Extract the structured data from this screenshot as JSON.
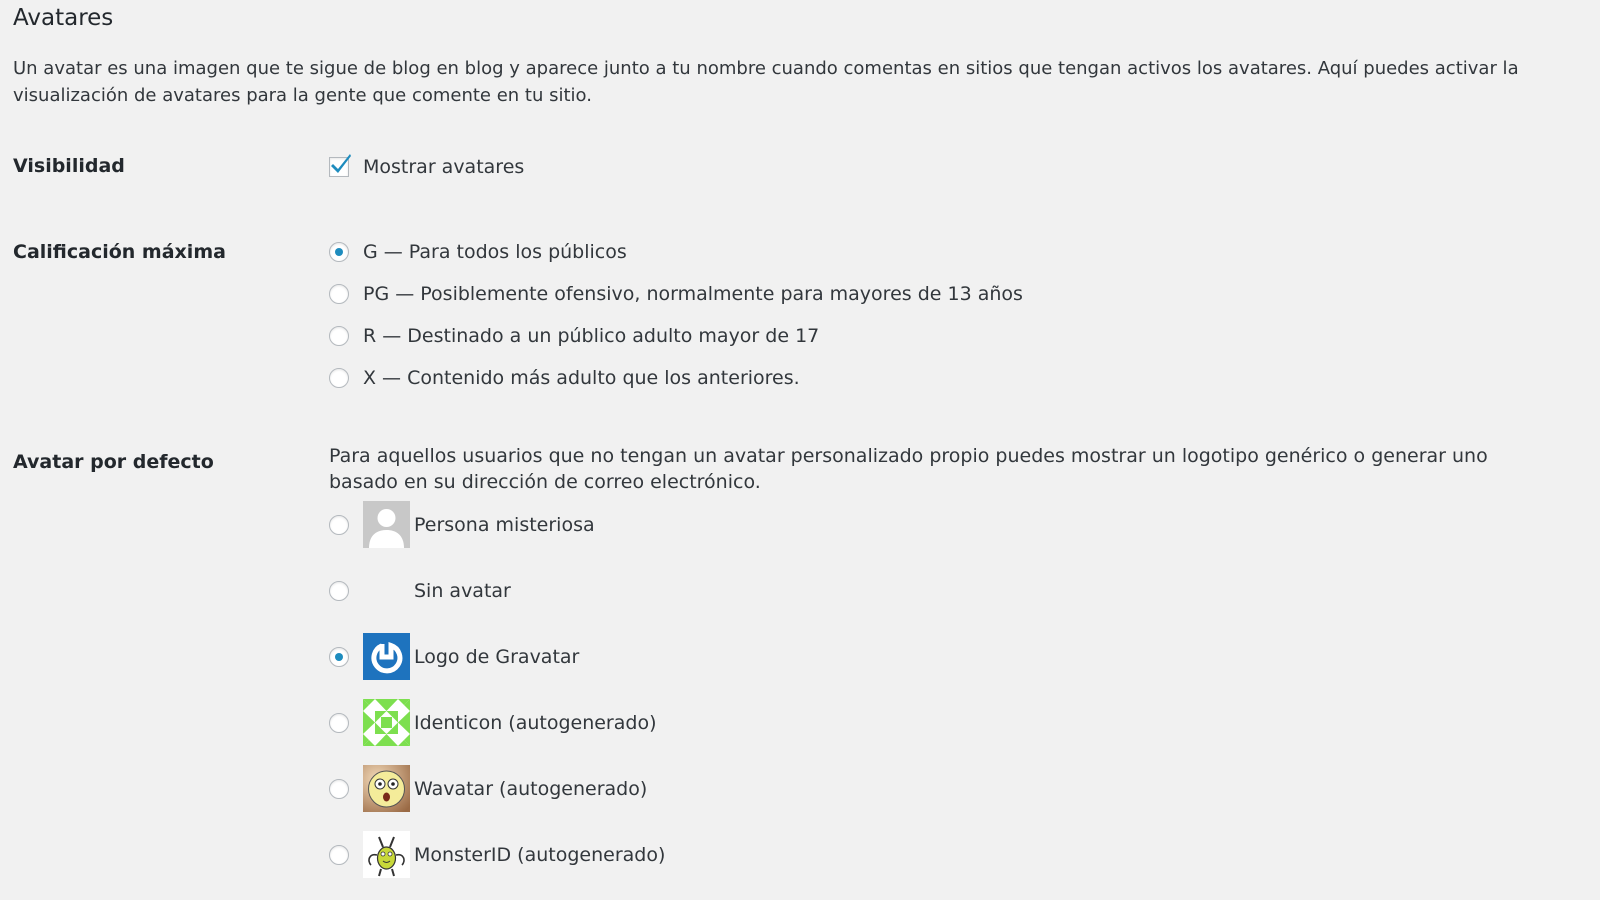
{
  "section": {
    "title": "Avatares",
    "intro": "Un avatar es una imagen que te sigue de blog en blog y aparece junto a tu nombre cuando comentas en sitios que tengan activos los avatares. Aquí puedes activar la visualización de avatares para la gente que comente en tu sitio."
  },
  "visibility": {
    "label": "Visibilidad",
    "checkbox_label": "Mostrar avatares",
    "checked": true
  },
  "rating": {
    "label": "Calificación máxima",
    "options": [
      {
        "label": "G — Para todos los públicos",
        "checked": true
      },
      {
        "label": "PG — Posiblemente ofensivo, normalmente para mayores de 13 años",
        "checked": false
      },
      {
        "label": "R — Destinado a un público adulto mayor de 17",
        "checked": false
      },
      {
        "label": "X — Contenido más adulto que los anteriores.",
        "checked": false
      }
    ]
  },
  "default_avatar": {
    "label": "Avatar por defecto",
    "description": "Para aquellos usuarios que no tengan un avatar personalizado propio puedes mostrar un logotipo genérico o generar uno basado en su dirección de correo electrónico.",
    "options": [
      {
        "label": "Persona misteriosa",
        "icon": "mystery-person-icon",
        "checked": false
      },
      {
        "label": "Sin avatar",
        "icon": "",
        "checked": false
      },
      {
        "label": "Logo de Gravatar",
        "icon": "gravatar-logo-icon",
        "checked": true
      },
      {
        "label": "Identicon (autogenerado)",
        "icon": "identicon-icon",
        "checked": false
      },
      {
        "label": "Wavatar (autogenerado)",
        "icon": "wavatar-icon",
        "checked": false
      },
      {
        "label": "MonsterID (autogenerado)",
        "icon": "monsterid-icon",
        "checked": false
      }
    ]
  },
  "colors": {
    "background": "#f1f1f1",
    "accent": "#1e8cbe",
    "gravatar_blue": "#1e73be",
    "identicon_green": "#7ddf4f"
  }
}
